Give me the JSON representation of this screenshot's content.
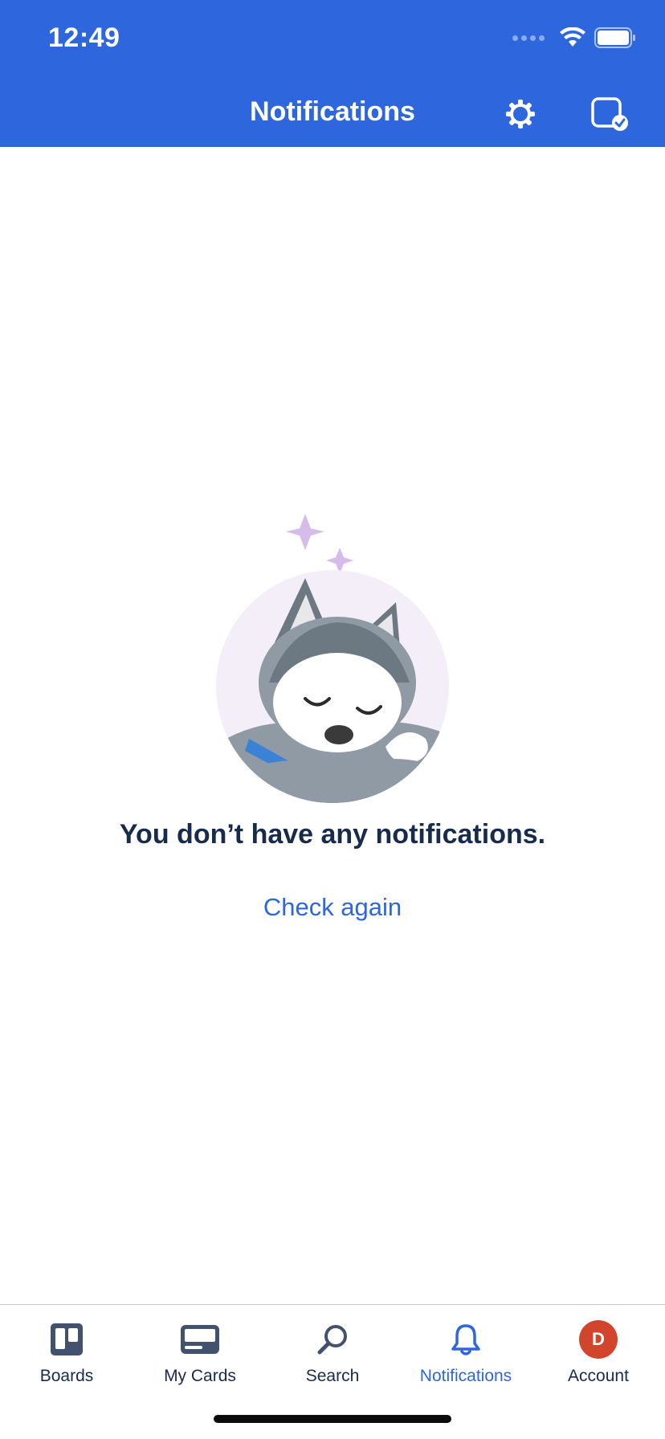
{
  "status_bar": {
    "time": "12:49"
  },
  "header": {
    "title": "Notifications",
    "settings_icon": "gear-icon",
    "switch_icon": "card-check-icon",
    "background": "#2e67dd"
  },
  "empty_state": {
    "message": "You don’t have any notifications.",
    "action_label": "Check again",
    "illustration": "sleeping-husky-illustration"
  },
  "tabbar": {
    "active": "Notifications",
    "items": [
      {
        "label": "Boards",
        "icon": "boards-icon"
      },
      {
        "label": "My Cards",
        "icon": "cards-icon"
      },
      {
        "label": "Search",
        "icon": "search-icon"
      },
      {
        "label": "Notifications",
        "icon": "bell-icon"
      },
      {
        "label": "Account",
        "icon": "avatar",
        "avatar_initial": "D"
      }
    ]
  },
  "colors": {
    "accent": "#2e67dd",
    "text": "#172b4d",
    "avatar": "#d2452d"
  }
}
